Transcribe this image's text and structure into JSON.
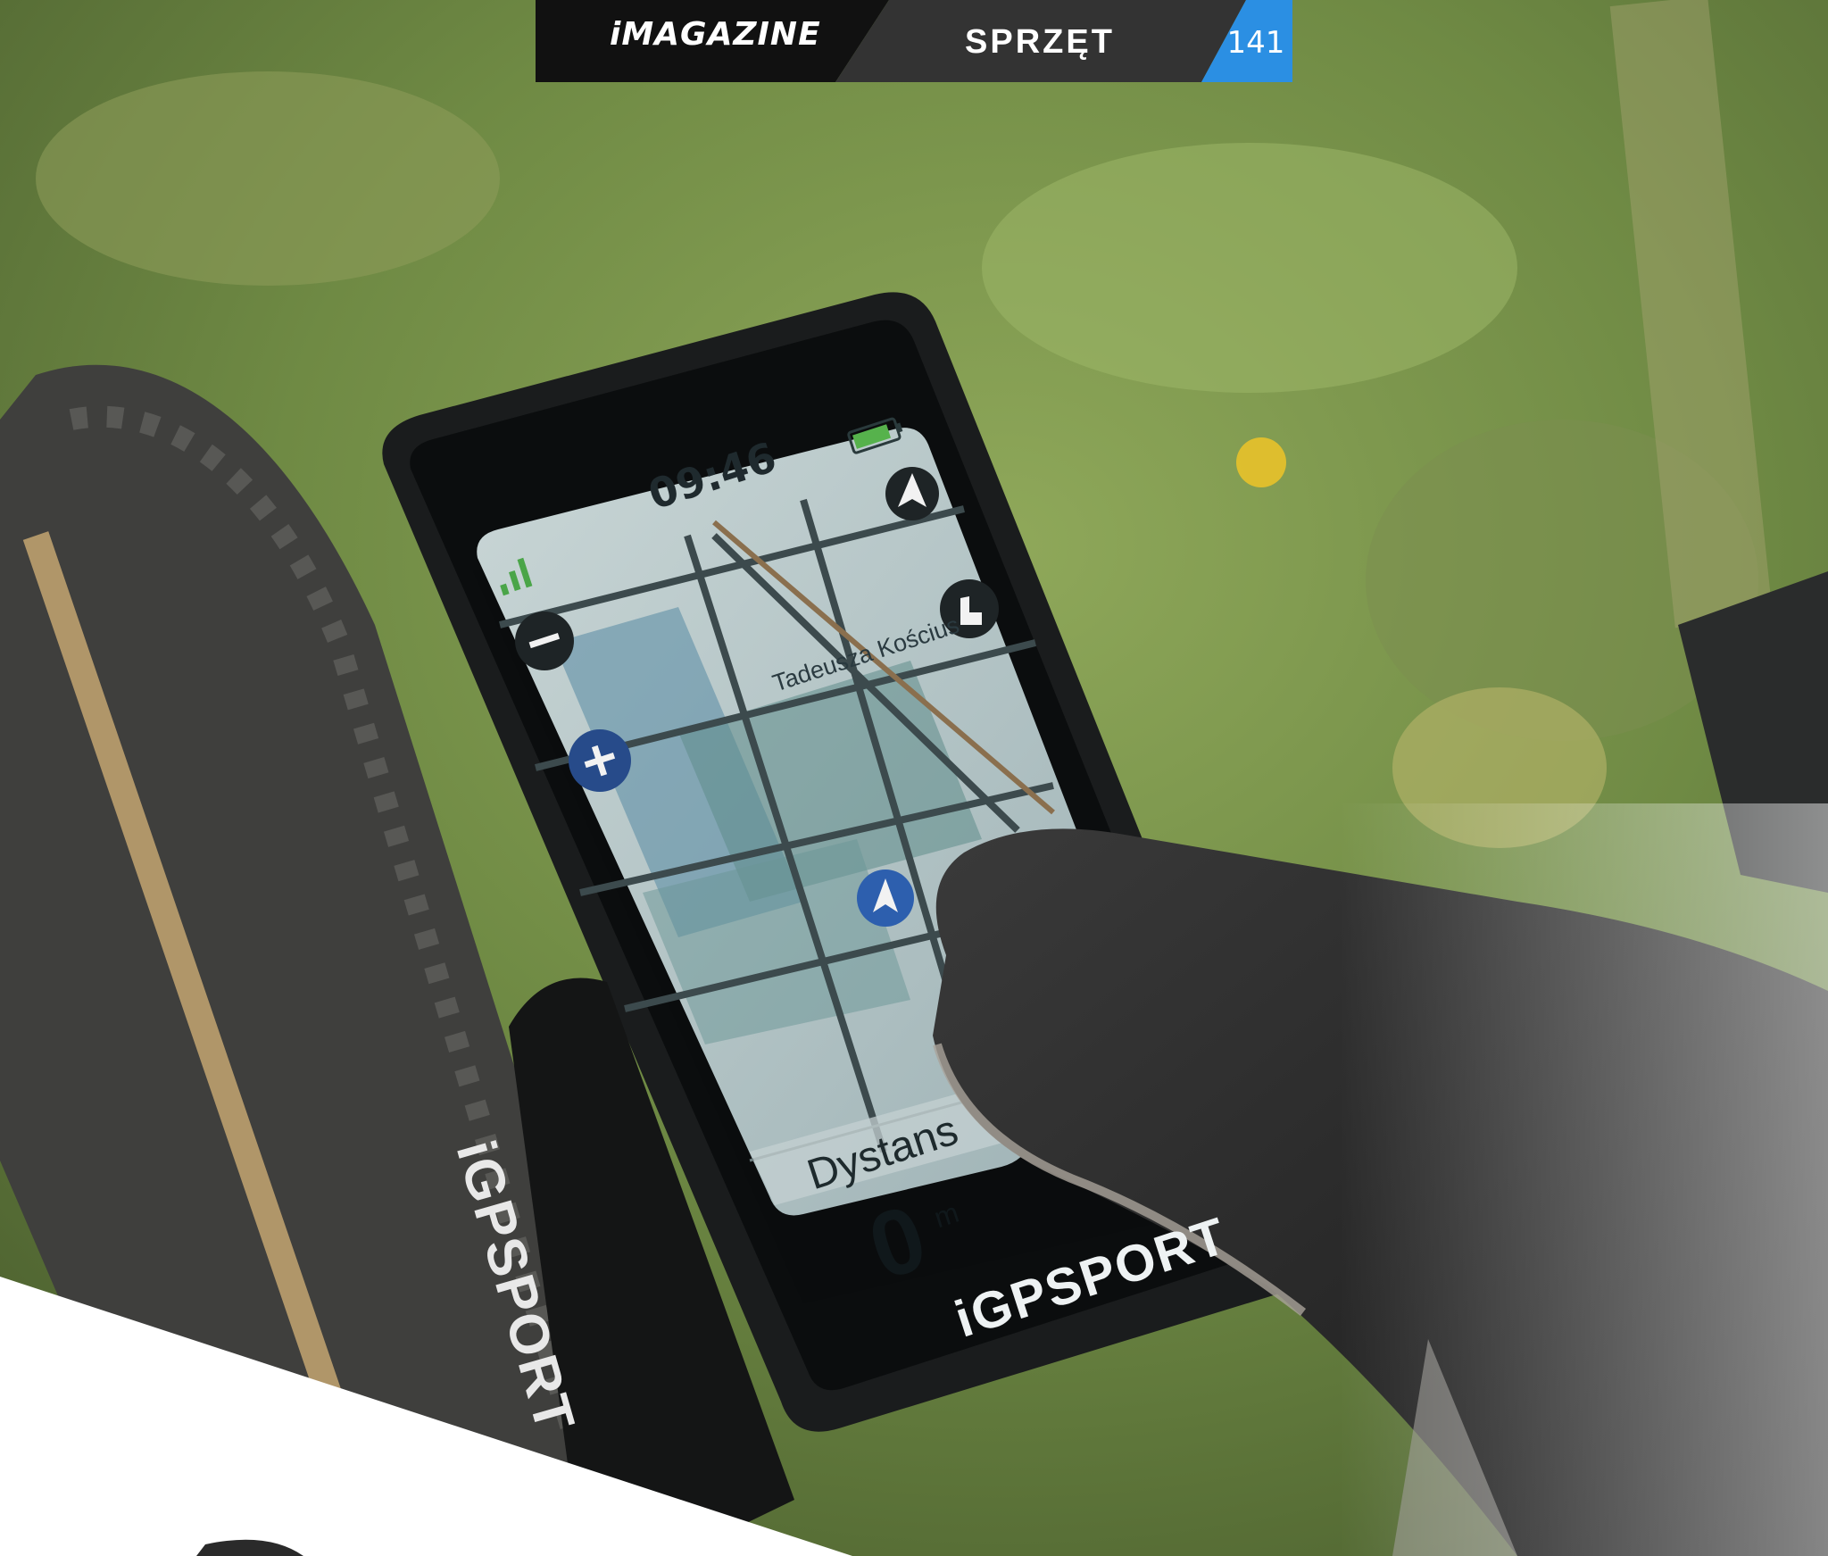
{
  "header": {
    "brand": "iMAGAZINE",
    "section": "SPRZĘT",
    "page_number": "141",
    "colors": {
      "bar": "#111111",
      "accent": "#2b8fe3"
    }
  },
  "device": {
    "clock": "09:46",
    "street_label": "Tadeusza Kościus",
    "distance_label": "Dystans",
    "distance_value": "0",
    "distance_unit": "m",
    "brand_logo": "iGPSPORT",
    "icons": [
      "signal-icon",
      "battery-icon",
      "compass-north-icon",
      "zoom-out-icon",
      "zoom-in-icon",
      "touch-icon",
      "position-arrow-icon"
    ]
  },
  "strap": {
    "brand_logo": "iGPSPORT"
  }
}
